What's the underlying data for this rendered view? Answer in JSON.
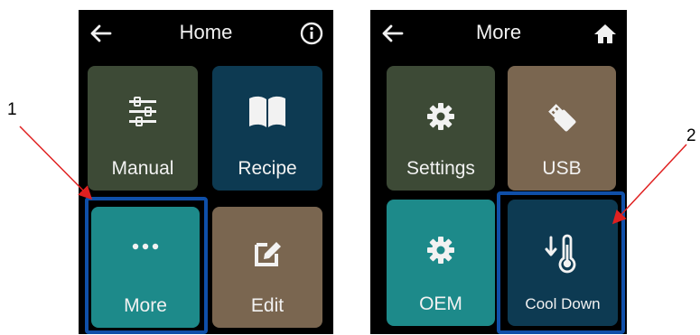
{
  "colors": {
    "screen_bg": "#000000",
    "tile_green": "#3d4a36",
    "tile_navy": "#0d3a52",
    "tile_teal": "#1d8a8a",
    "tile_brown": "#7a6650",
    "highlight_border": "#0f4fa8",
    "callout_arrow": "#e02020"
  },
  "home_screen": {
    "title": "Home",
    "back_icon": "arrow-left-icon",
    "right_icon": "info-icon",
    "tiles": [
      {
        "label": "Manual",
        "icon": "sliders-icon"
      },
      {
        "label": "Recipe",
        "icon": "open-book-icon"
      },
      {
        "label": "More",
        "icon": "ellipsis-icon"
      },
      {
        "label": "Edit",
        "icon": "edit-icon"
      }
    ]
  },
  "more_screen": {
    "title": "More",
    "back_icon": "arrow-left-icon",
    "right_icon": "home-icon",
    "tiles": [
      {
        "label": "Settings",
        "icon": "gear-icon"
      },
      {
        "label": "USB",
        "icon": "usb-drive-icon"
      },
      {
        "label": "OEM",
        "icon": "gear-icon"
      },
      {
        "label": "Cool Down",
        "icon": "thermometer-down-icon"
      }
    ]
  },
  "callouts": [
    {
      "label": "1"
    },
    {
      "label": "2"
    }
  ]
}
